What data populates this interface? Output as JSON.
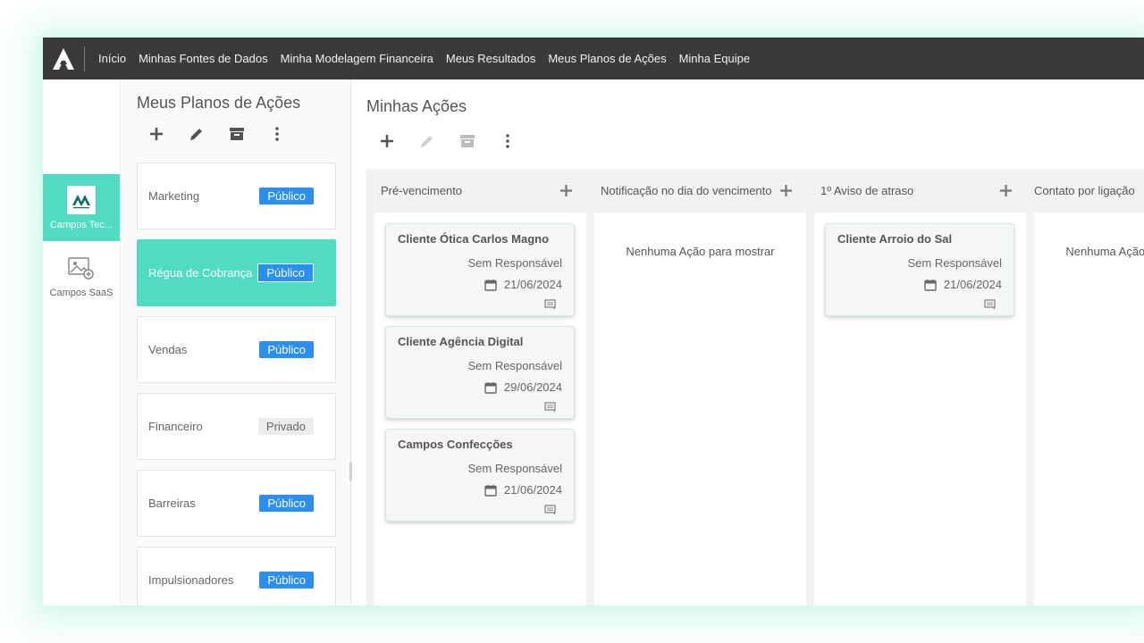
{
  "nav": {
    "items": [
      "Início",
      "Minhas Fontes de Dados",
      "Minha Modelagem Financeira",
      "Meus Resultados",
      "Meus Planos de Ações",
      "Minha Equipe"
    ]
  },
  "rail": {
    "items": [
      {
        "label": "Campos Tec...",
        "active": true
      },
      {
        "label": "Campos SaaS",
        "active": false
      }
    ]
  },
  "plans": {
    "title": "Meus Planos de Ações",
    "items": [
      {
        "name": "Marketing",
        "visibility": "Público",
        "active": false
      },
      {
        "name": "Régua de Cobrança",
        "visibility": "Público",
        "active": true
      },
      {
        "name": "Vendas",
        "visibility": "Público",
        "active": false
      },
      {
        "name": "Financeiro",
        "visibility": "Privado",
        "active": false
      },
      {
        "name": "Barreiras",
        "visibility": "Público",
        "active": false
      },
      {
        "name": "Impulsionadores",
        "visibility": "Público",
        "active": false
      }
    ]
  },
  "actions": {
    "title": "Minhas Ações",
    "columns": [
      {
        "title": "Pré-vencimento",
        "empty_message": "",
        "cards": [
          {
            "title": "Cliente Ótica Carlos Magno",
            "owner": "Sem Responsável",
            "date": "21/06/2024"
          },
          {
            "title": "Cliente Agência Digital",
            "owner": "Sem Responsável",
            "date": "29/06/2024"
          },
          {
            "title": "Campos Confecções",
            "owner": "Sem Responsável",
            "date": "21/06/2024"
          }
        ]
      },
      {
        "title": "Notificação no dia do vencimento",
        "empty_message": "Nenhuma Ação para mostrar",
        "cards": []
      },
      {
        "title": "1º Aviso de atraso",
        "empty_message": "",
        "cards": [
          {
            "title": "Cliente Arroio do Sal",
            "owner": "Sem Responsável",
            "date": "21/06/2024"
          }
        ]
      },
      {
        "title": "Contato por ligação",
        "empty_message": "Nenhuma Ação para mostrar",
        "cards": []
      }
    ]
  },
  "colors": {
    "topbar": "#3a3a3a",
    "accent": "#4fdcc0",
    "badge_public": "#2b8ff0",
    "badge_private": "#ececec"
  }
}
